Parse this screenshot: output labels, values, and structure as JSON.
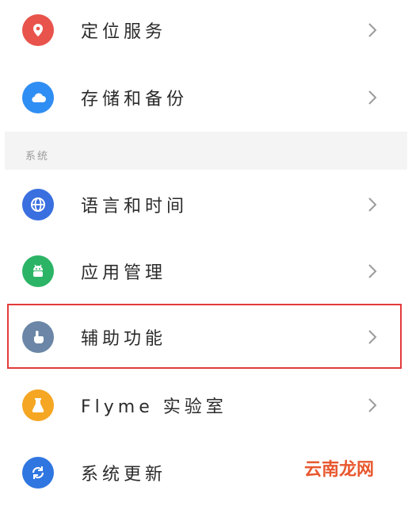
{
  "items": [
    {
      "label": "定位服务",
      "icon": "location-pin-icon",
      "color": "#e8534c"
    },
    {
      "label": "存储和备份",
      "icon": "cloud-icon",
      "color": "#2f8ef3"
    },
    {
      "label": "语言和时间",
      "icon": "globe-icon",
      "color": "#3a6fe0"
    },
    {
      "label": "应用管理",
      "icon": "android-icon",
      "color": "#2bb465"
    },
    {
      "label": "辅助功能",
      "icon": "hand-pointer-icon",
      "color": "#6b86a6"
    },
    {
      "label": "Flyme 实验室",
      "icon": "flask-icon",
      "color": "#f5a623"
    },
    {
      "label": "系统更新",
      "icon": "refresh-icon",
      "color": "#2f76e0"
    }
  ],
  "section": {
    "label": "系统"
  },
  "watermark": "云南龙网",
  "colors": {
    "highlight_border": "#e33b3b",
    "section_bg": "#f4f4f4"
  }
}
